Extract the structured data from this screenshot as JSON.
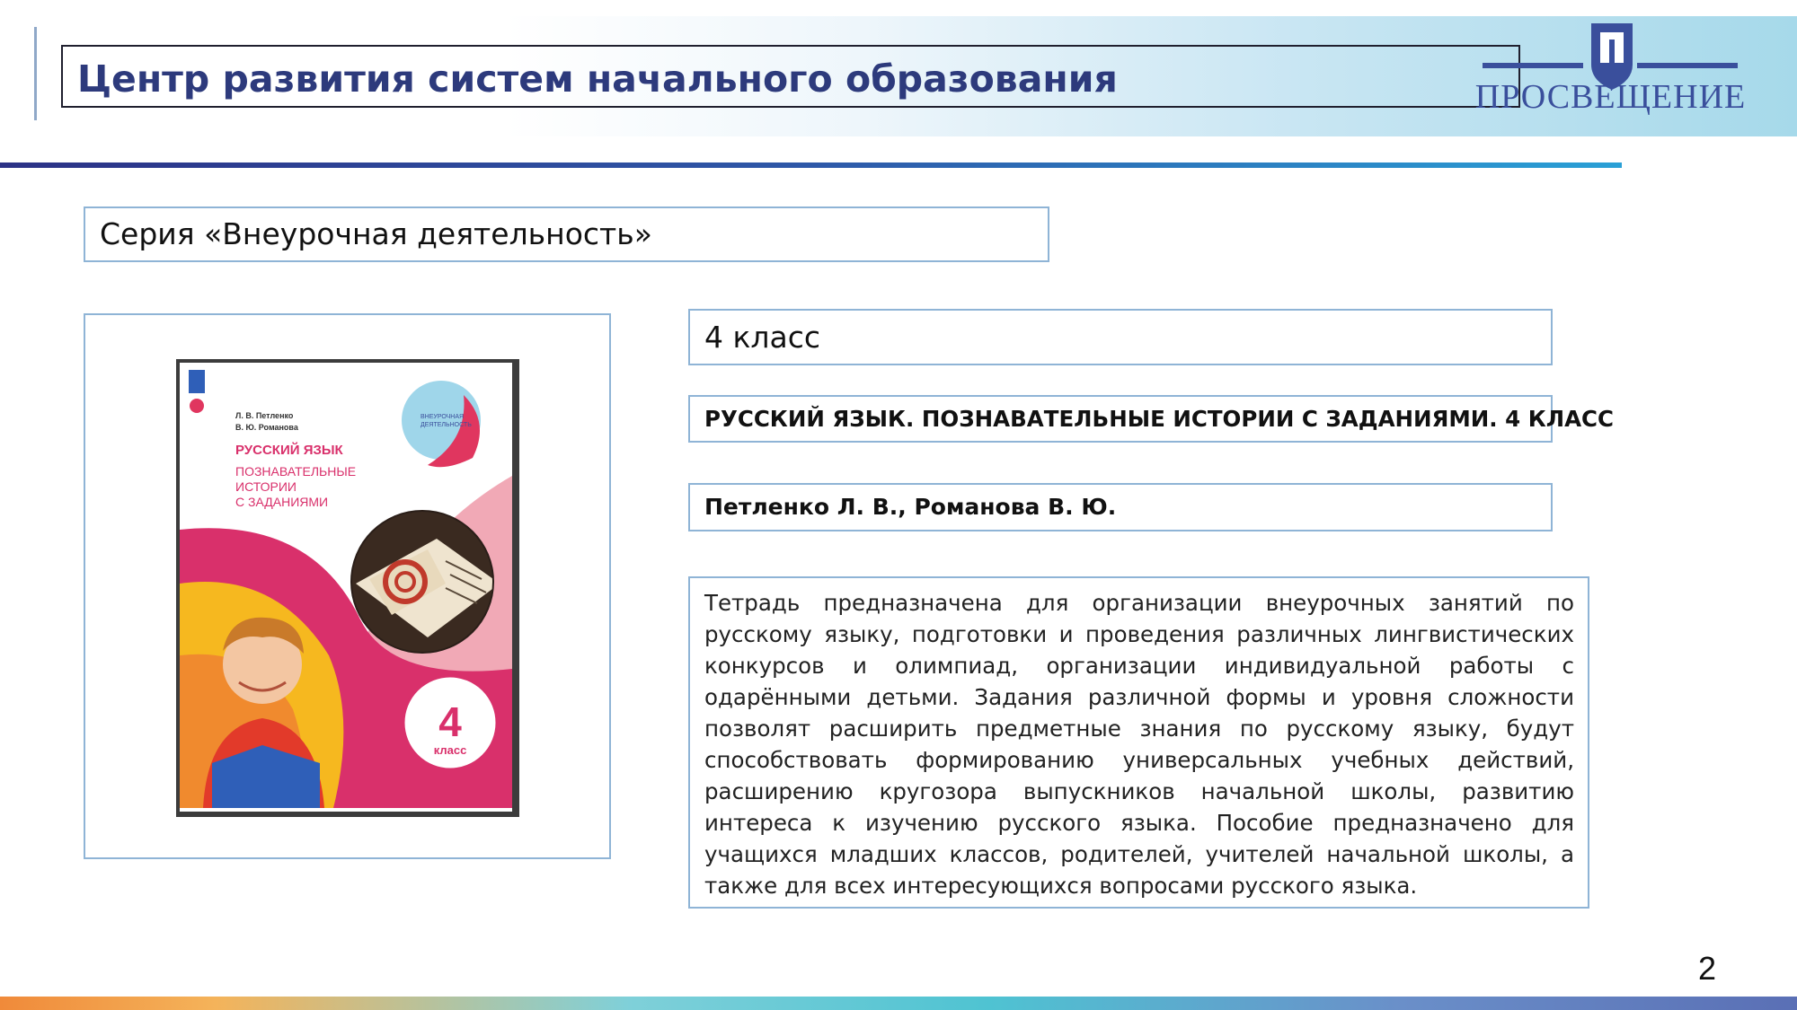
{
  "header": {
    "title": "Центр развития систем начального образования",
    "logo_text": "ПРОСВЕЩЕНИЕ"
  },
  "series": {
    "label": "Серия «Внеурочная деятельность»"
  },
  "book": {
    "grade": "4 класс",
    "title": "РУССКИЙ ЯЗЫК. ПОЗНАВАТЕЛЬНЫЕ ИСТОРИИ С ЗАДАНИЯМИ. 4 КЛАСС",
    "authors": "Петленко Л. В., Романова В. Ю.",
    "description": "Тетрадь предназначена для организации внеурочных занятий по русскому языку, подготовки и проведения различных лингвистических конкурсов и олимпиад, организации индивидуальной работы с одарёнными детьми. Задания различной формы и уровня сложности позволят расширить предметные знания по русскому языку, будут способствовать формированию универсальных учебных действий, расширению кругозора выпускников начальной школы, развитию интереса к изучению русского языка. Пособие предназначено для учащихся младших классов, родителей, учителей начальной школы, а также для всех интересующихся вопросами русского языка."
  },
  "cover": {
    "authors_line1": "Л. В. Петленко",
    "authors_line2": "В. Ю. Романова",
    "subject": "РУССКИЙ ЯЗЫК",
    "subtitle_line1": "ПОЗНАВАТЕЛЬНЫЕ",
    "subtitle_line2": "ИСТОРИИ",
    "subtitle_line3": "С ЗАДАНИЯМИ",
    "badge_line1": "ВНЕУРОЧНАЯ",
    "badge_line2": "ДЕЯТЕЛЬНОСТЬ",
    "grade_number": "4",
    "grade_word": "класс"
  },
  "page_number": "2",
  "colors": {
    "header_title": "#2d3a7c",
    "box_border": "#8fb4d6",
    "cover_pink": "#d9306b",
    "cover_yellow": "#f6b81f",
    "logo_blue": "#3a4f9c"
  }
}
